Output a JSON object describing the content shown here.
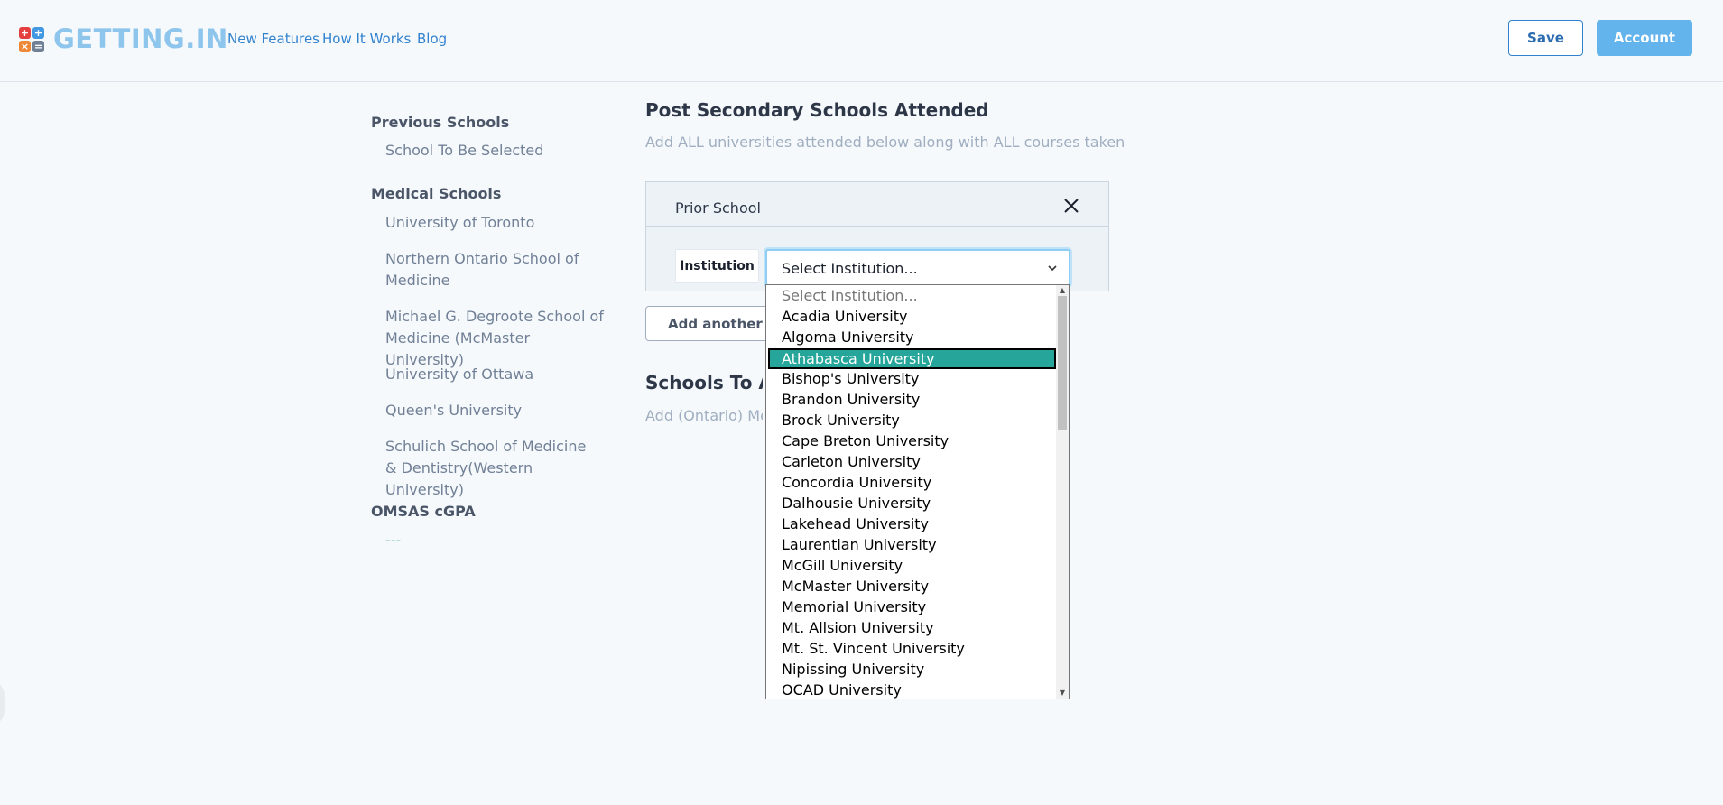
{
  "header": {
    "logo_text": "GETTING.IN",
    "nav": [
      "New Features",
      "How It Works",
      "Blog"
    ],
    "save_label": "Save",
    "account_label": "Account"
  },
  "sidebar": {
    "previous_heading": "Previous Schools",
    "previous_items": [
      "School To Be Selected"
    ],
    "medical_heading": "Medical Schools",
    "medical_items": [
      "University of Toronto",
      "Northern Ontario School of Medicine",
      "Michael G. Degroote School of Medicine (McMaster University)",
      "University of Ottawa",
      "Queen's University",
      "Schulich School of Medicine & Dentistry(Western University)"
    ],
    "omsas_heading": "OMSAS cGPA",
    "omsas_value": "---"
  },
  "main": {
    "title": "Post Secondary Schools Attended",
    "subtitle": "Add ALL universities attended below along with ALL courses taken",
    "panel_title": "Prior School",
    "institution_label": "Institution",
    "select_value": "Select Institution...",
    "add_button": "Add another School",
    "section2_title": "Schools To Apply To",
    "section2_subtitle": "Add (Ontario) Medical Schools"
  },
  "dropdown": {
    "selected_index": 3,
    "options": [
      "Select Institution...",
      "Acadia University",
      "Algoma University",
      "Athabasca University",
      "Bishop's University",
      "Brandon University",
      "Brock University",
      "Cape Breton University",
      "Carleton University",
      "Concordia University",
      "Dalhousie University",
      "Lakehead University",
      "Laurentian University",
      "McGill University",
      "McMaster University",
      "Memorial University",
      "Mt. Allsion University",
      "Mt. St. Vincent University",
      "Nipissing University",
      "OCAD University"
    ]
  },
  "colors": {
    "accent": "#3182ce",
    "logo": "#8ec5ec",
    "selected_option": "#26a69a",
    "cgpa": "#38a169"
  }
}
